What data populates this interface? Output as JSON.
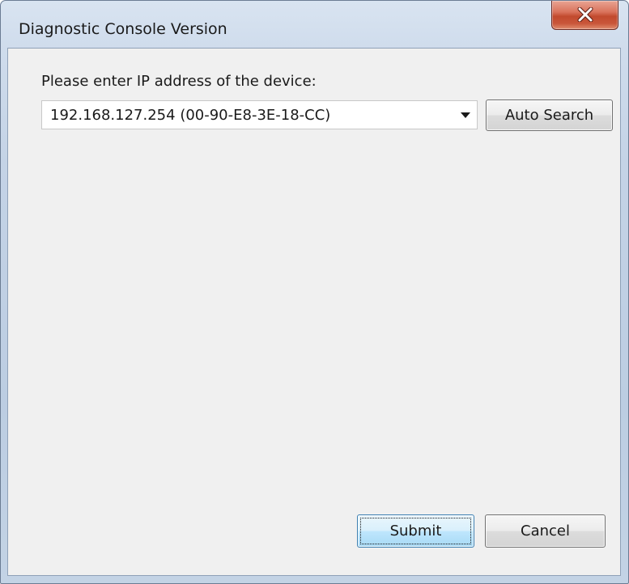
{
  "window": {
    "title": "Diagnostic Console Version"
  },
  "titlebar": {
    "close_icon": "close-icon"
  },
  "form": {
    "prompt_label": "Please enter IP address of the device:",
    "ip_combo": {
      "selected_value": "192.168.127.254 (00-90-E8-3E-18-CC)",
      "arrow_icon": "chevron-down-icon"
    },
    "auto_search_label": "Auto Search"
  },
  "footer": {
    "submit_label": "Submit",
    "cancel_label": "Cancel"
  },
  "colors": {
    "close_button": "#c24a2e",
    "client_background": "#f0f0f0",
    "default_button_border": "#3c7fb1"
  }
}
